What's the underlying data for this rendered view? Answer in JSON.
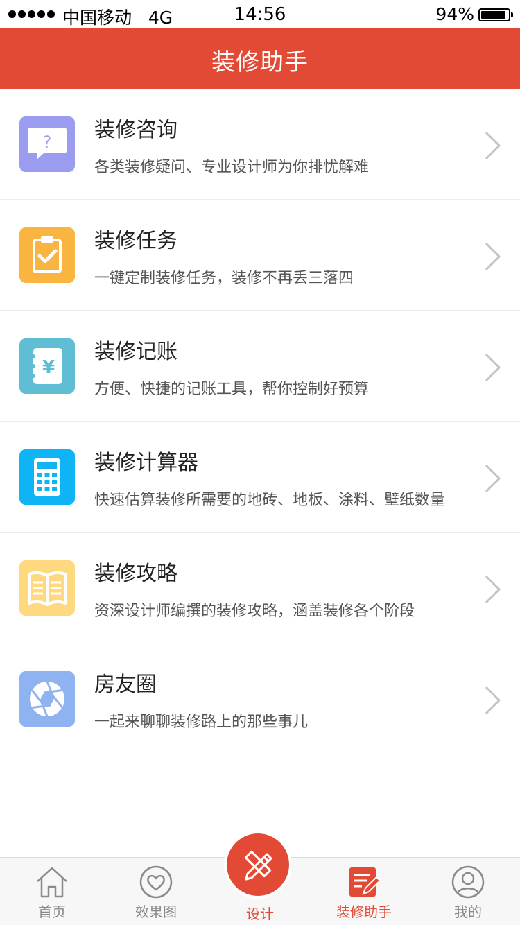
{
  "status_bar": {
    "carrier": "中国移动",
    "network": "4G",
    "time": "14:56",
    "battery": "94%",
    "battery_level": 0.94
  },
  "header": {
    "title": "装修助手",
    "background_color": "#e34a36"
  },
  "menu": [
    {
      "title": "装修咨询",
      "desc": "各类装修疑问、专业设计师为你排忧解难",
      "icon": "question-bubble-icon",
      "color": "#9b9cf0"
    },
    {
      "title": "装修任务",
      "desc": "一键定制装修任务，装修不再丢三落四",
      "icon": "clipboard-check-icon",
      "color": "#f9b53f"
    },
    {
      "title": "装修记账",
      "desc": "方便、快捷的记账工具，帮你控制好预算",
      "icon": "ledger-yen-icon",
      "color": "#5fbdd4"
    },
    {
      "title": "装修计算器",
      "desc": "快速估算装修所需要的地砖、地板、涂料、壁纸数量",
      "icon": "calculator-icon",
      "color": "#0fb4f4"
    },
    {
      "title": "装修攻略",
      "desc": "资深设计师编撰的装修攻略，涵盖装修各个阶段",
      "icon": "open-book-icon",
      "color": "#ffd97f"
    },
    {
      "title": "房友圈",
      "desc": "一起来聊聊装修路上的那些事儿",
      "icon": "aperture-icon",
      "color": "#8fb2f0"
    }
  ],
  "tabbar": {
    "tabs": [
      {
        "label": "首页",
        "icon": "home-icon"
      },
      {
        "label": "效果图",
        "icon": "heart-icon"
      },
      {
        "label": "设计",
        "icon": "pencil-ruler-icon"
      },
      {
        "label": "装修助手",
        "icon": "notepad-pen-icon"
      },
      {
        "label": "我的",
        "icon": "user-icon"
      }
    ],
    "active": "装修助手",
    "accent_color": "#e34a36"
  }
}
